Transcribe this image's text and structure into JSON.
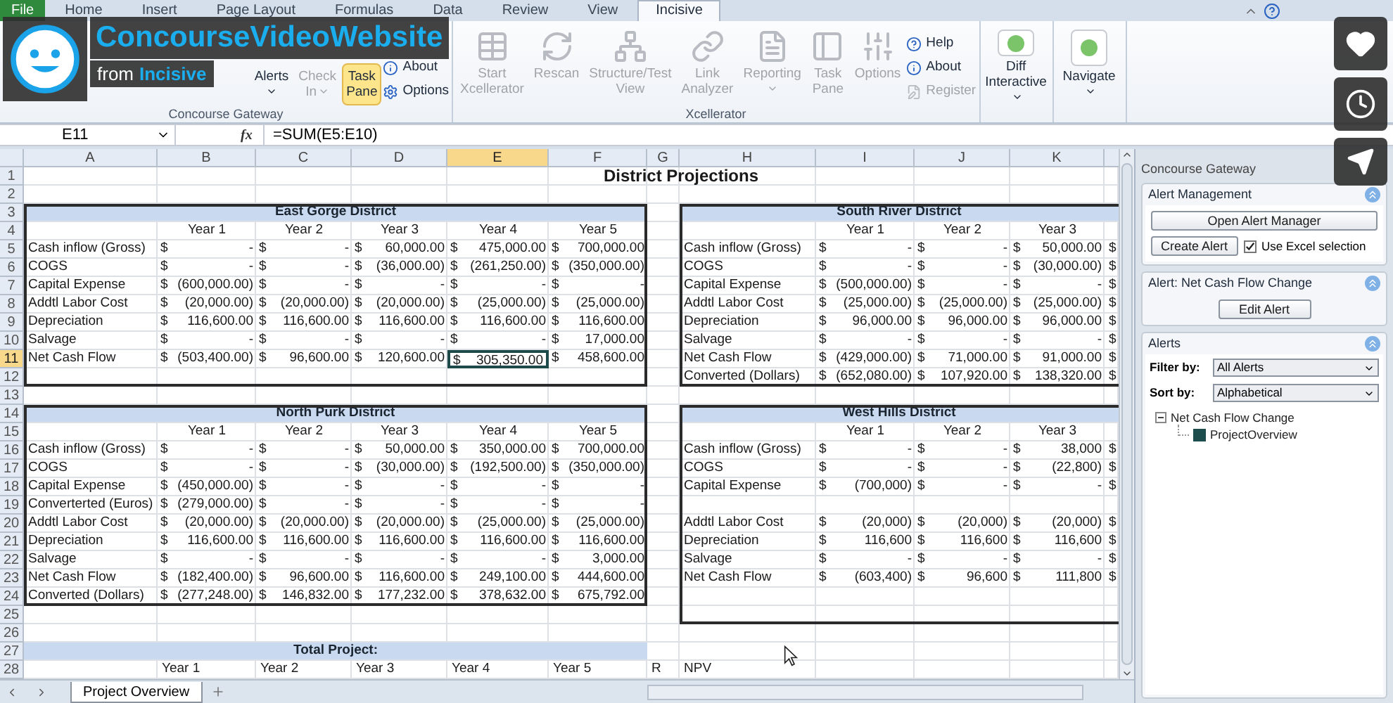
{
  "video": {
    "title": "ConcourseVideoWebsite",
    "byline_prefix": "from",
    "author": "Incisive"
  },
  "ribbon": {
    "tabs": [
      {
        "label": "File",
        "kind": "file",
        "selected": false
      },
      {
        "label": "Home",
        "kind": "tab",
        "selected": false
      },
      {
        "label": "Insert",
        "kind": "tab",
        "selected": false
      },
      {
        "label": "Page Layout",
        "kind": "tab",
        "selected": false
      },
      {
        "label": "Formulas",
        "kind": "tab",
        "selected": false
      },
      {
        "label": "Data",
        "kind": "tab",
        "selected": false
      },
      {
        "label": "Review",
        "kind": "tab",
        "selected": false
      },
      {
        "label": "View",
        "kind": "tab",
        "selected": false
      },
      {
        "label": "Incisive",
        "kind": "tab",
        "selected": true
      }
    ],
    "groups": [
      {
        "label": "Concourse Gateway",
        "items": [
          {
            "kind": "large",
            "label": "Alerts",
            "disabled": false,
            "dropdown": true,
            "highlighted": false
          },
          {
            "kind": "large",
            "label": "Check In",
            "disabled": true,
            "dropdown": true,
            "highlighted": false
          },
          {
            "kind": "large",
            "label": "Task Pane",
            "disabled": false,
            "highlighted": true
          },
          {
            "kind": "stack",
            "items": [
              {
                "label": "About",
                "disabled": false
              },
              {
                "label": "Options",
                "disabled": false
              }
            ]
          }
        ]
      },
      {
        "label": "Xcellerator",
        "items": [
          {
            "kind": "large",
            "label": "Start Xcellerator",
            "disabled": true,
            "highlighted": false
          },
          {
            "kind": "large",
            "label": "Rescan",
            "disabled": true,
            "highlighted": false
          },
          {
            "kind": "large",
            "label": "Structure/Test View",
            "disabled": true,
            "highlighted": false
          },
          {
            "kind": "large",
            "label": "Link Analyzer",
            "disabled": true,
            "highlighted": false
          },
          {
            "kind": "large",
            "label": "Reporting",
            "disabled": true,
            "dropdown": true,
            "highlighted": false
          },
          {
            "kind": "large",
            "label": "Task Pane",
            "disabled": true,
            "highlighted": false
          },
          {
            "kind": "large",
            "label": "Options",
            "disabled": true,
            "highlighted": false
          },
          {
            "kind": "stack",
            "items": [
              {
                "label": "Help",
                "disabled": false
              },
              {
                "label": "About",
                "disabled": false
              },
              {
                "label": "Register",
                "disabled": true
              }
            ]
          }
        ]
      },
      {
        "items": [
          {
            "kind": "large",
            "label": "Diff Interactive",
            "disabled": false,
            "dropdown": true,
            "highlighted": false
          }
        ]
      },
      {
        "items": [
          {
            "kind": "large",
            "label": "Navigate",
            "disabled": false,
            "dropdown": true,
            "highlighted": false
          }
        ]
      }
    ]
  },
  "formula_bar": {
    "name_box": "E11",
    "function_label": "fx",
    "formula": "=SUM(E5:E10)"
  },
  "sheet": {
    "columns": [
      {
        "label": "A",
        "selected": false
      },
      {
        "label": "B",
        "selected": false
      },
      {
        "label": "C",
        "selected": false
      },
      {
        "label": "D",
        "selected": false
      },
      {
        "label": "E",
        "selected": true
      },
      {
        "label": "F",
        "selected": false
      },
      {
        "label": "G",
        "selected": false
      },
      {
        "label": "H",
        "selected": false
      },
      {
        "label": "I",
        "selected": false
      },
      {
        "label": "J",
        "selected": false
      },
      {
        "label": "K",
        "selected": false
      }
    ],
    "rows": [
      {
        "num": "1",
        "selected": false,
        "cells": [
          null,
          null,
          null,
          null,
          null,
          null,
          {
            "text": "District Projections",
            "kind": "title"
          }
        ]
      },
      {
        "num": "2",
        "selected": false,
        "cells": []
      },
      {
        "num": "3",
        "selected": false,
        "cells": [
          {
            "text": "East Gorge District",
            "kind": "band"
          },
          null,
          null,
          null,
          null,
          null,
          null,
          {
            "text": "South River District",
            "kind": "band"
          }
        ]
      },
      {
        "num": "4",
        "selected": false,
        "cells": [
          null,
          {
            "text": "Year 1",
            "kind": "heading"
          },
          {
            "text": "Year 2",
            "kind": "heading"
          },
          {
            "text": "Year 3",
            "kind": "heading"
          },
          {
            "text": "Year 4",
            "kind": "heading"
          },
          {
            "text": "Year 5",
            "kind": "heading"
          },
          null,
          null,
          {
            "text": "Year 1",
            "kind": "heading"
          },
          {
            "text": "Year 2",
            "kind": "heading"
          },
          {
            "text": "Year 3",
            "kind": "heading"
          }
        ]
      },
      {
        "num": "5",
        "selected": false,
        "cells": [
          "Cash inflow (Gross)",
          [
            "$",
            "-"
          ],
          [
            "$",
            "-"
          ],
          [
            "$",
            "60,000.00"
          ],
          [
            "$",
            "475,000.00"
          ],
          [
            "$",
            "700,000.00"
          ],
          null,
          "Cash inflow (Gross)",
          [
            "$",
            "-"
          ],
          [
            "$",
            "-"
          ],
          [
            "$",
            "50,000.00"
          ],
          "$"
        ]
      },
      {
        "num": "6",
        "selected": false,
        "cells": [
          "COGS",
          [
            "$",
            "-"
          ],
          [
            "$",
            "-"
          ],
          [
            "$",
            "(36,000.00)"
          ],
          [
            "$",
            "(261,250.00)"
          ],
          [
            "$",
            "(350,000.00)"
          ],
          null,
          "COGS",
          [
            "$",
            "-"
          ],
          [
            "$",
            "-"
          ],
          [
            "$",
            "(30,000.00)"
          ],
          "$"
        ]
      },
      {
        "num": "7",
        "selected": false,
        "cells": [
          "Capital Expense",
          [
            "$",
            "(600,000.00)"
          ],
          [
            "$",
            "-"
          ],
          [
            "$",
            "-"
          ],
          [
            "$",
            "-"
          ],
          [
            "$",
            "-"
          ],
          null,
          "Capital Expense",
          [
            "$",
            "(500,000.00)"
          ],
          [
            "$",
            "-"
          ],
          [
            "$",
            "-"
          ],
          "$"
        ]
      },
      {
        "num": "8",
        "selected": false,
        "cells": [
          "Addtl Labor Cost",
          [
            "$",
            "(20,000.00)"
          ],
          [
            "$",
            "(20,000.00)"
          ],
          [
            "$",
            "(20,000.00)"
          ],
          [
            "$",
            "(25,000.00)"
          ],
          [
            "$",
            "(25,000.00)"
          ],
          null,
          "Addtl Labor Cost",
          [
            "$",
            "(25,000.00)"
          ],
          [
            "$",
            "(25,000.00)"
          ],
          [
            "$",
            "(25,000.00)"
          ],
          "$"
        ]
      },
      {
        "num": "9",
        "selected": false,
        "cells": [
          "Depreciation",
          [
            "$",
            "116,600.00"
          ],
          [
            "$",
            "116,600.00"
          ],
          [
            "$",
            "116,600.00"
          ],
          [
            "$",
            "116,600.00"
          ],
          [
            "$",
            "116,600.00"
          ],
          null,
          "Depreciation",
          [
            "$",
            "96,000.00"
          ],
          [
            "$",
            "96,000.00"
          ],
          [
            "$",
            "96,000.00"
          ],
          "$"
        ]
      },
      {
        "num": "10",
        "selected": false,
        "cells": [
          "Salvage",
          [
            "$",
            "-"
          ],
          [
            "$",
            "-"
          ],
          [
            "$",
            "-"
          ],
          [
            "$",
            "-"
          ],
          [
            "$",
            "17,000.00"
          ],
          null,
          "Salvage",
          [
            "$",
            "-"
          ],
          [
            "$",
            "-"
          ],
          [
            "$",
            "-"
          ],
          "$"
        ]
      },
      {
        "num": "11",
        "selected": true,
        "cells": [
          "Net Cash Flow",
          [
            "$",
            "(503,400.00)"
          ],
          [
            "$",
            "96,600.00"
          ],
          [
            "$",
            "120,600.00"
          ],
          [
            "$",
            "305,350.00"
          ],
          [
            "$",
            "458,600.00"
          ],
          null,
          "Net Cash Flow",
          [
            "$",
            "(429,000.00)"
          ],
          [
            "$",
            "71,000.00"
          ],
          [
            "$",
            "91,000.00"
          ],
          "$"
        ]
      },
      {
        "num": "12",
        "selected": false,
        "cells": [
          null,
          null,
          null,
          null,
          null,
          null,
          null,
          "Converted (Dollars)",
          [
            "$",
            "(652,080.00)"
          ],
          [
            "$",
            "107,920.00"
          ],
          [
            "$",
            "138,320.00"
          ],
          "$"
        ]
      },
      {
        "num": "13",
        "selected": false,
        "cells": []
      },
      {
        "num": "14",
        "selected": false,
        "cells": [
          {
            "text": "North Purk District",
            "kind": "band"
          },
          null,
          null,
          null,
          null,
          null,
          null,
          {
            "text": "West Hills District",
            "kind": "band"
          }
        ]
      },
      {
        "num": "15",
        "selected": false,
        "cells": [
          null,
          {
            "text": "Year 1",
            "kind": "heading"
          },
          {
            "text": "Year 2",
            "kind": "heading"
          },
          {
            "text": "Year 3",
            "kind": "heading"
          },
          {
            "text": "Year 4",
            "kind": "heading"
          },
          {
            "text": "Year 5",
            "kind": "heading"
          },
          null,
          null,
          {
            "text": "Year 1",
            "kind": "heading"
          },
          {
            "text": "Year 2",
            "kind": "heading"
          },
          {
            "text": "Year 3",
            "kind": "heading"
          }
        ]
      },
      {
        "num": "16",
        "selected": false,
        "cells": [
          "Cash inflow (Gross)",
          [
            "$",
            "-"
          ],
          [
            "$",
            "-"
          ],
          [
            "$",
            "50,000.00"
          ],
          [
            "$",
            "350,000.00"
          ],
          [
            "$",
            "700,000.00"
          ],
          null,
          "Cash inflow (Gross)",
          [
            "$",
            "-"
          ],
          [
            "$",
            "-"
          ],
          [
            "$",
            "38,000"
          ],
          "$"
        ]
      },
      {
        "num": "17",
        "selected": false,
        "cells": [
          "COGS",
          [
            "$",
            "-"
          ],
          [
            "$",
            "-"
          ],
          [
            "$",
            "(30,000.00)"
          ],
          [
            "$",
            "(192,500.00)"
          ],
          [
            "$",
            "(350,000.00)"
          ],
          null,
          "COGS",
          [
            "$",
            "-"
          ],
          [
            "$",
            "-"
          ],
          [
            "$",
            "(22,800)"
          ],
          "$"
        ]
      },
      {
        "num": "18",
        "selected": false,
        "cells": [
          "Capital Expense",
          [
            "$",
            "(450,000.00)"
          ],
          [
            "$",
            "-"
          ],
          [
            "$",
            "-"
          ],
          [
            "$",
            "-"
          ],
          [
            "$",
            "-"
          ],
          null,
          "Capital Expense",
          [
            "$",
            "(700,000)"
          ],
          [
            "$",
            "-"
          ],
          [
            "$",
            "-"
          ],
          "$"
        ]
      },
      {
        "num": "19",
        "selected": false,
        "cells": [
          "Converterted (Euros)",
          [
            "$",
            "(279,000.00)"
          ],
          [
            "$",
            "-"
          ],
          [
            "$",
            "-"
          ],
          [
            "$",
            "-"
          ],
          [
            "$",
            "-"
          ]
        ]
      },
      {
        "num": "20",
        "selected": false,
        "cells": [
          "Addtl Labor Cost",
          [
            "$",
            "(20,000.00)"
          ],
          [
            "$",
            "(20,000.00)"
          ],
          [
            "$",
            "(20,000.00)"
          ],
          [
            "$",
            "(25,000.00)"
          ],
          [
            "$",
            "(25,000.00)"
          ],
          null,
          "Addtl Labor Cost",
          [
            "$",
            "(20,000)"
          ],
          [
            "$",
            "(20,000)"
          ],
          [
            "$",
            "(20,000)"
          ],
          "$"
        ]
      },
      {
        "num": "21",
        "selected": false,
        "cells": [
          "Depreciation",
          [
            "$",
            "116,600.00"
          ],
          [
            "$",
            "116,600.00"
          ],
          [
            "$",
            "116,600.00"
          ],
          [
            "$",
            "116,600.00"
          ],
          [
            "$",
            "116,600.00"
          ],
          null,
          "Depreciation",
          [
            "$",
            "116,600"
          ],
          [
            "$",
            "116,600"
          ],
          [
            "$",
            "116,600"
          ],
          "$"
        ]
      },
      {
        "num": "22",
        "selected": false,
        "cells": [
          "Salvage",
          [
            "$",
            "-"
          ],
          [
            "$",
            "-"
          ],
          [
            "$",
            "-"
          ],
          [
            "$",
            "-"
          ],
          [
            "$",
            "3,000.00"
          ],
          null,
          "Salvage",
          [
            "$",
            "-"
          ],
          [
            "$",
            "-"
          ],
          [
            "$",
            "-"
          ],
          "$"
        ]
      },
      {
        "num": "23",
        "selected": false,
        "cells": [
          "Net Cash Flow",
          [
            "$",
            "(182,400.00)"
          ],
          [
            "$",
            "96,600.00"
          ],
          [
            "$",
            "116,600.00"
          ],
          [
            "$",
            "249,100.00"
          ],
          [
            "$",
            "444,600.00"
          ],
          null,
          "Net Cash Flow",
          [
            "$",
            "(603,400)"
          ],
          [
            "$",
            "96,600"
          ],
          [
            "$",
            "111,800"
          ],
          "$"
        ]
      },
      {
        "num": "24",
        "selected": false,
        "cells": [
          "Converted (Dollars)",
          [
            "$",
            "(277,248.00)"
          ],
          [
            "$",
            "146,832.00"
          ],
          [
            "$",
            "177,232.00"
          ],
          [
            "$",
            "378,632.00"
          ],
          [
            "$",
            "675,792.00"
          ]
        ]
      },
      {
        "num": "25",
        "selected": false,
        "cells": []
      },
      {
        "num": "26",
        "selected": false,
        "cells": []
      },
      {
        "num": "27",
        "selected": false,
        "cells": [
          {
            "text": "Total Project:",
            "kind": "band"
          }
        ]
      },
      {
        "num": "28",
        "selected": false,
        "cells": [
          null,
          "Year 1",
          "Year 2",
          "Year 3",
          "Year 4",
          "Year 5",
          "R",
          "NPV"
        ]
      }
    ],
    "sheet_tabs": [
      {
        "label": "Project Overview",
        "selected": true
      }
    ]
  },
  "task_pane": {
    "title": "Concourse Gateway",
    "alert_management": {
      "title": "Alert Management",
      "open_button": "Open Alert Manager",
      "create_button": "Create Alert",
      "use_selection": {
        "label": "Use Excel selection",
        "checked": true
      }
    },
    "alert_detail": {
      "title": "Alert: Net Cash Flow Change",
      "edit_button": "Edit Alert"
    },
    "alerts": {
      "title": "Alerts",
      "filter": {
        "label": "Filter by:",
        "value": "All Alerts"
      },
      "sort": {
        "label": "Sort by:",
        "value": "Alphabetical"
      },
      "tree": [
        {
          "label": "Net Cash Flow Change",
          "expanded": true,
          "children": [
            {
              "label": "ProjectOverview"
            }
          ]
        }
      ]
    }
  }
}
